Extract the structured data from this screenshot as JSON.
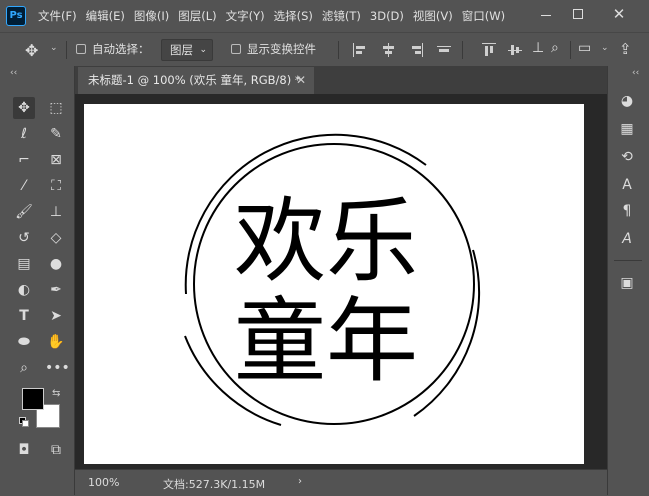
{
  "app": {
    "logo": "Ps"
  },
  "menu": [
    "文件(F)",
    "编辑(E)",
    "图像(I)",
    "图层(L)",
    "文字(Y)",
    "选择(S)",
    "滤镜(T)",
    "3D(D)",
    "视图(V)",
    "窗口(W)"
  ],
  "window_controls": {
    "close_glyph": "✕"
  },
  "options": {
    "auto_select_label": "自动选择：",
    "auto_select_target": "图层",
    "show_transform_label": "显示变换控件"
  },
  "document": {
    "tab_title": "未标题-1 @ 100% (欢乐 童年, RGB/8) *",
    "close_glyph": "✕",
    "zoom": "100%",
    "doc_info": "文档:527.3K/1.15M"
  },
  "artwork": {
    "line1": "欢乐",
    "line2": "童年",
    "text_color": "#000000",
    "background": "#ffffff"
  },
  "colors": {
    "foreground": "#000000",
    "background": "#ffffff",
    "ui_panel": "#535353",
    "ui_dark": "#282828"
  },
  "toolbar_icons": [
    "move-tool-icon",
    "marquee-tool-icon",
    "lasso-tool-icon",
    "quick-selection-tool-icon",
    "crop-tool-icon",
    "frame-tool-icon",
    "eyedropper-tool-icon",
    "spot-healing-tool-icon",
    "brush-tool-icon",
    "clone-stamp-tool-icon",
    "history-brush-tool-icon",
    "eraser-tool-icon",
    "gradient-tool-icon",
    "blur-tool-icon",
    "dodge-tool-icon",
    "pen-tool-icon",
    "type-tool-icon",
    "path-selection-tool-icon",
    "ellipse-tool-icon",
    "hand-tool-icon",
    "zoom-tool-icon",
    "more-tools-icon",
    "quick-mask-icon",
    "screen-mode-icon"
  ],
  "right_panel_icons": [
    "color-panel-icon",
    "swatches-panel-icon",
    "history-panel-icon",
    "character-panel-icon",
    "paragraph-panel-icon",
    "glyphs-panel-icon",
    "layers-panel-icon"
  ]
}
